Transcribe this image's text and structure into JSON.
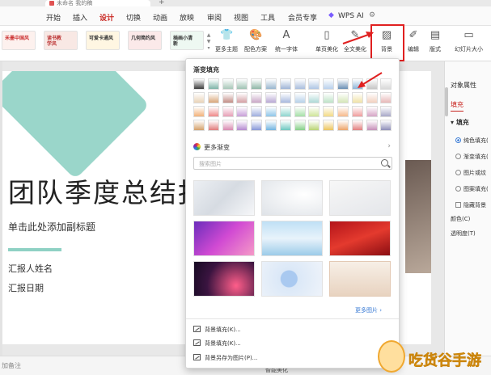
{
  "titlebar": {
    "doc_tab": "未命名 我的稿",
    "new_tab_symbol": "+"
  },
  "menu": {
    "items": [
      "开始",
      "插入",
      "设计",
      "切换",
      "动画",
      "放映",
      "审阅",
      "视图",
      "工具",
      "会员专享"
    ],
    "active": "设计",
    "wps_ai": "WPS AI"
  },
  "ribbon": {
    "themes": [
      "禾墨中国风",
      "读书教学风",
      "可爱卡通风",
      "几何简约风",
      "插画小清新"
    ],
    "buttons": {
      "more_themes": "更多主题",
      "color_scheme": "配色方案",
      "unify_font": "统一字体",
      "single_page_beautify": "单页美化",
      "full_beautify": "全文美化",
      "background": "背景",
      "edit": "编辑",
      "layout": "版式",
      "slide_size": "幻灯片大小"
    }
  },
  "slide": {
    "title": "团队季度总结报",
    "subtitle": "单击此处添加副标题",
    "reporter": "汇报人姓名",
    "date": "汇报日期"
  },
  "dropdown": {
    "gradient_heading": "渐变填充",
    "more_gradients": "更多渐变",
    "search_placeholder": "搜索图片",
    "more_images": "更多图片",
    "actions": [
      "背景填充(K)...",
      "背景填充(K)...",
      "背景另存为图片(P)..."
    ]
  },
  "right_pane": {
    "title": "对象属性",
    "tab": "填充",
    "section": "填充",
    "options": [
      "纯色填充(",
      "渐变填充(",
      "图片或纹",
      "图案填充("
    ],
    "checkbox": "隐藏背景",
    "color_label": "颜色(C)",
    "transparency_label": "透明度(T)"
  },
  "statusbar": {
    "notes_hint": "加备注",
    "beautify": "智能美化"
  },
  "watermark": {
    "text": "吃货谷手游"
  },
  "colors": {
    "accent_red": "#c8241f",
    "slide_teal": "#8fd1c4",
    "highlight_red": "#e02020"
  }
}
